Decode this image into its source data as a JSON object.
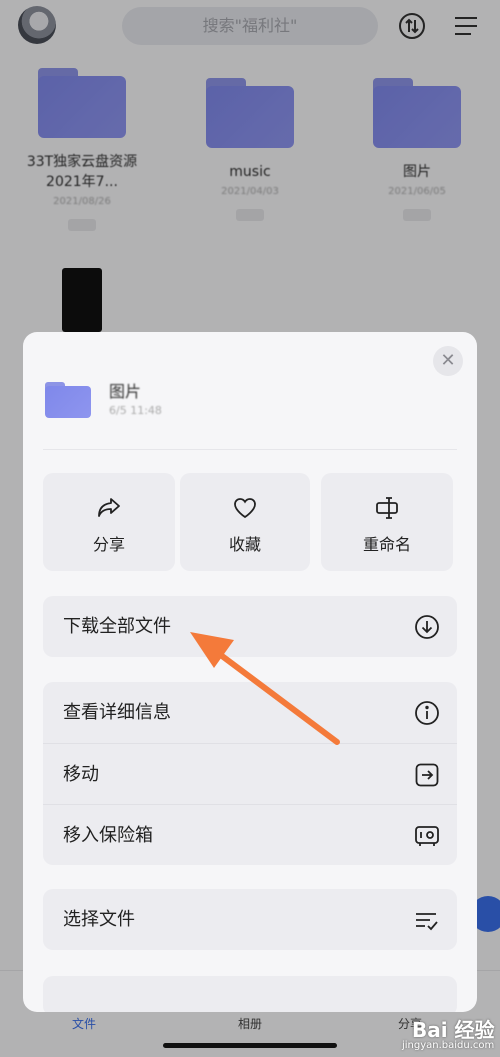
{
  "app": {
    "search_placeholder": "搜索\"福利社\"",
    "grid": [
      {
        "name": "33T独家云盘资源2021年7...",
        "sub": "2021/08/26"
      },
      {
        "name": "music",
        "sub": "2021/04/03"
      },
      {
        "name": "图片",
        "sub": "2021/06/05"
      }
    ],
    "bottom_tabs": [
      {
        "label": "文件"
      },
      {
        "label": "相册"
      },
      {
        "label": "分享"
      }
    ]
  },
  "sheet": {
    "file_name": "图片",
    "file_date": "6/5 11:48",
    "actions": [
      {
        "label": "分享",
        "icon": "share-icon"
      },
      {
        "label": "收藏",
        "icon": "heart-icon"
      },
      {
        "label": "重命名",
        "icon": "rename-icon"
      }
    ],
    "download_all": "下载全部文件",
    "details": "查看详细信息",
    "move": "移动",
    "vault": "移入保险箱",
    "select_files": "选择文件"
  },
  "annotation": {
    "arrow_color": "#f47a3a"
  },
  "watermark": {
    "brand": "Bai 经验",
    "site": "jingyan.baidu.com"
  }
}
